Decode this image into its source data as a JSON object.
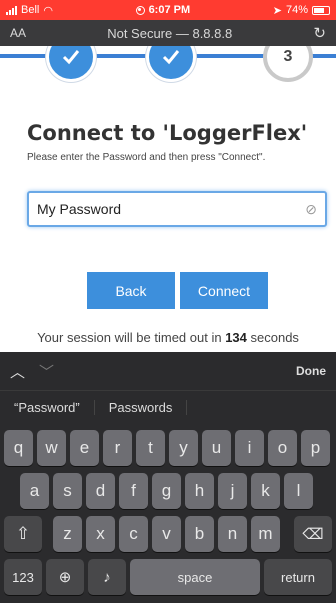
{
  "status_bar": {
    "carrier": "Bell",
    "time": "6:07 PM",
    "battery": "74%",
    "battery_level": 0.74
  },
  "browser": {
    "text_size_label": "AA",
    "url": "Not Secure — 8.8.8.8",
    "reload_icon": "reload-icon"
  },
  "steps": {
    "items": [
      {
        "state": "done"
      },
      {
        "state": "done"
      },
      {
        "state": "current",
        "label": "3"
      }
    ]
  },
  "page": {
    "title": "Connect to 'LoggerFlex'",
    "subtitle": "Please enter the Password and then press \"Connect\".",
    "password_value": "My Password",
    "back_label": "Back",
    "connect_label": "Connect",
    "timeout_prefix": "Your session will be timed out in ",
    "timeout_seconds": "134",
    "timeout_suffix": " seconds"
  },
  "keyboard": {
    "done_label": "Done",
    "suggestions": [
      "“Password”",
      "Passwords"
    ],
    "row1": [
      "q",
      "w",
      "e",
      "r",
      "t",
      "y",
      "u",
      "i",
      "o",
      "p"
    ],
    "row2": [
      "a",
      "s",
      "d",
      "f",
      "g",
      "h",
      "j",
      "k",
      "l"
    ],
    "row3": [
      "z",
      "x",
      "c",
      "v",
      "b",
      "n",
      "m"
    ],
    "numbers_label": "123",
    "space_label": "space",
    "return_label": "return"
  }
}
